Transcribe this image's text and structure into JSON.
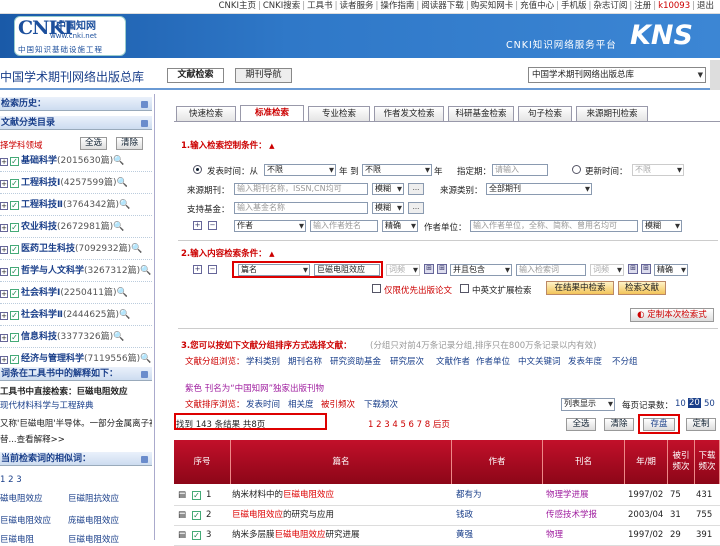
{
  "topbar": {
    "items": [
      "CNKI主页",
      "CNKI搜索",
      "工具书",
      "读者服务",
      "操作指南",
      "阅读器下载",
      "购买知网卡",
      "充值中心",
      "手机版",
      "杂志订阅",
      "注册"
    ],
    "user": "k10093",
    "logout": "退出"
  },
  "banner": {
    "logo_main": "CNKI",
    "logo_cn": "中国知网",
    "logo_url": "www.cnki.net",
    "logo_sub": "中国知识基础设施工程",
    "subtitle": "CNKI知识网络服务平台",
    "kns": "KNS"
  },
  "nav": {
    "db_title": "中国学术期刊网络出版总库",
    "tab_doc": "文献检索",
    "tab_nav": "期刊导航",
    "db_select": "中国学术期刊网络出版总库"
  },
  "sidebar": {
    "history_header": "检索历史：",
    "category_header": "文献分类目录",
    "select_field_label": "择学科领域",
    "select_all": "全选",
    "clear": "清除",
    "categories": [
      {
        "name": "基础科学",
        "count": "(2015630篇)"
      },
      {
        "name": "工程科技Ⅰ",
        "count": "(4257599篇)"
      },
      {
        "name": "工程科技Ⅱ",
        "count": "(3764342篇)"
      },
      {
        "name": "农业科技",
        "count": "(2672981篇)"
      },
      {
        "name": "医药卫生科技",
        "count": "(7092932篇)"
      },
      {
        "name": "哲学与人文科学",
        "count": "(3267312篇)"
      },
      {
        "name": "社会科学Ⅰ",
        "count": "(2250411篇)"
      },
      {
        "name": "社会科学Ⅱ",
        "count": "(2444625篇)"
      },
      {
        "name": "信息科技",
        "count": "(3377326篇)"
      },
      {
        "name": "经济与管理科学",
        "count": "(7119556篇)"
      }
    ],
    "toolbook_header": "词条在工具书中的解释如下：",
    "toolbook_lines": [
      "工具书中直接检索：巨磁电阻效应",
      "现代材料科学与工程辞典",
      "又称'巨磁电阻'半导体。一部分金属离子被",
      "替...查看解释>>"
    ],
    "related_header": "当前检索词的相似词：",
    "related_pages": "1 2 3",
    "related_words": [
      "磁电阻效应",
      "巨磁阻抗效应",
      "巨磁电阻效应",
      "庞磁电阻效应",
      "巨磁电阻",
      "巨磁电阻效应"
    ]
  },
  "search_tabs": [
    "快速检索",
    "标准检索",
    "专业检索",
    "作者发文检索",
    "科研基金检索",
    "句子检索",
    "来源期刊检索"
  ],
  "section1": {
    "title": "1.输入检索控制条件：",
    "pub_year_label": "发表时间：从",
    "from": "不限",
    "to_label": "年 到",
    "to": "不限",
    "year_suffix": "年",
    "specified_label": "指定期：",
    "specified_placeholder": "请输入",
    "update_label": "更新时间：",
    "update_value": "不限",
    "source_label": "来源期刊：",
    "source_placeholder": "输入期刊名称，ISSN,CN均可",
    "fuzzy": "模糊",
    "dots": "...",
    "source_cat_label": "来源类别：",
    "source_cat": "全部期刊",
    "fund_label": "支持基金：",
    "fund_placeholder": "输入基金名称",
    "author_field": "作者",
    "author_placeholder": "输入作者姓名",
    "exact": "精确",
    "unit_label": "作者单位：",
    "unit_placeholder": "输入作者单位，全称、简称、曾用名均可"
  },
  "section2": {
    "title": "2.输入内容检索条件：",
    "field": "篇名",
    "term": "巨磁电阻效应",
    "freq": "词频",
    "and_contains": "并且包含",
    "term2_placeholder": "输入检索词",
    "freq2": "词频",
    "exact": "精确",
    "priority_label": "仅限优先出版论文",
    "cn_ext_label": "中英文扩展检索",
    "search_in_results": "在结果中检索",
    "search": "检索文献",
    "custom": "定制本次检索式"
  },
  "section3": {
    "title": "3.您可以按如下文献分组排序方式选择文献：",
    "note": "(分组只对前4万条记录分组,排序只在800万条记录以内有效)",
    "group_label": "文献分组浏览：",
    "groups": [
      "学科类别",
      "期刊名称",
      "研究资助基金",
      "研究层次",
      "文献作者",
      "作者单位",
      "中文关键词",
      "发表年度",
      "不分组"
    ],
    "purple_note": "紫色 刊名为“中国知网”独家出版刊物",
    "sort_label": "文献排序浏览：",
    "sorts": [
      "发表时间",
      "相关度",
      "被引频次",
      "下载频次"
    ],
    "list_display": "列表显示",
    "per_page_label": "每页记录数：",
    "per_page": [
      "10",
      "20",
      "50"
    ],
    "result_text": "找到 143 条结果 共8页",
    "pages": "1 2 3 4 5 6 7 8 后页",
    "select_all": "全选",
    "clear": "清除",
    "save": "存盘",
    "custom": "定制"
  },
  "table": {
    "headers": [
      "序号",
      "篇名",
      "作者",
      "刊名",
      "年/期",
      "被引频次",
      "下载频次"
    ],
    "rows": [
      {
        "no": "1",
        "title_pre": "纳米材料中的",
        "title_hl": "巨磁电阻效应",
        "title_post": "",
        "author": "都有为",
        "journal": "物理学进展",
        "year": "1997/02",
        "cited": "75",
        "down": "431"
      },
      {
        "no": "2",
        "title_pre": "",
        "title_hl": "巨磁电阻效应",
        "title_post": "的研究与应用",
        "author": "钱政",
        "journal": "传感技术学报",
        "year": "2003/04",
        "cited": "31",
        "down": "755"
      },
      {
        "no": "3",
        "title_pre": "纳米多层膜",
        "title_hl": "巨磁电阻效应",
        "title_post": "研究进展",
        "author": "黄强",
        "journal": "物理",
        "year": "1997/02",
        "cited": "29",
        "down": "391"
      }
    ]
  }
}
